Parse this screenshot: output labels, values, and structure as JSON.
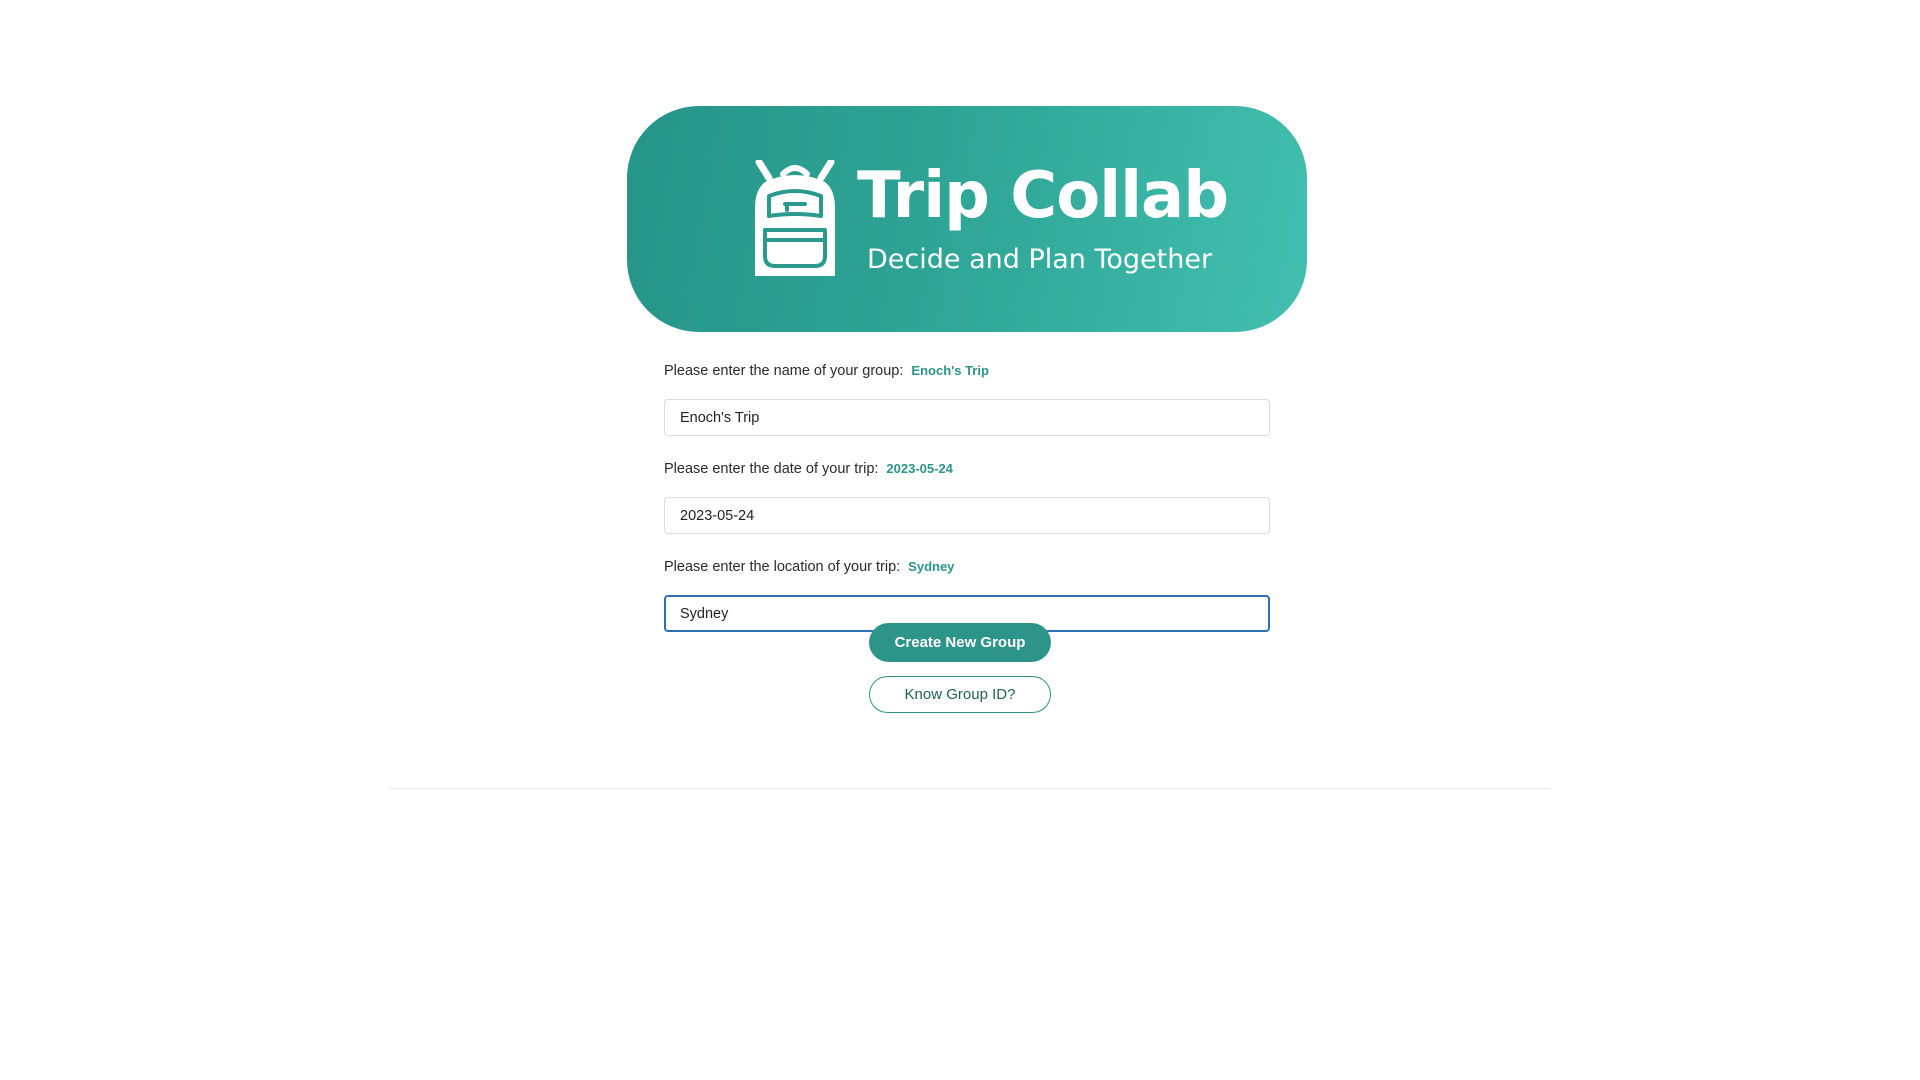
{
  "header": {
    "logo_icon": "backpack-icon",
    "title": "Trip Collab",
    "subtitle": "Decide and Plan Together",
    "gradient_start": "#259488",
    "gradient_end": "#42bfb0"
  },
  "form": {
    "group_name": {
      "label": "Please enter the name of your group:",
      "preview": "Enoch's Trip",
      "value": "Enoch's Trip"
    },
    "trip_date": {
      "label": "Please enter the date of your trip:",
      "preview": "2023-05-24",
      "value": "2023-05-24"
    },
    "trip_location": {
      "label": "Please enter the location of your trip:",
      "preview": "Sydney",
      "value": "Sydney"
    }
  },
  "actions": {
    "create_label": "Create New Group",
    "know_id_label": "Know Group ID?"
  },
  "colors": {
    "accent": "#2c9488",
    "focus_border": "#2f6fb5"
  }
}
